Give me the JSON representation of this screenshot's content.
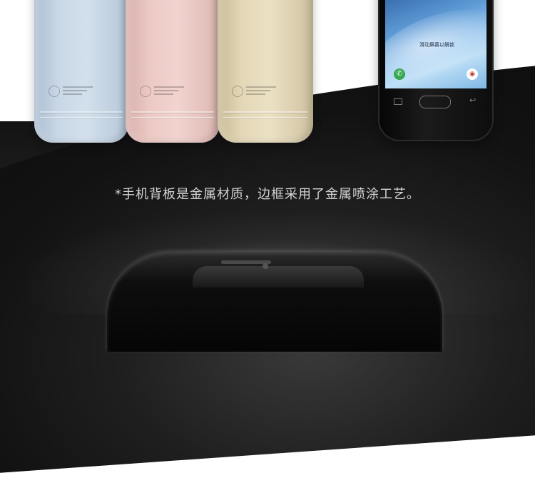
{
  "caption": "*手机背板是金属材质，边框采用了金属喷涂工艺。",
  "front_screen_text": "滑动屏幕以解锁",
  "icons": {
    "call": "phone-call-icon",
    "camera": "camera-icon",
    "recent": "recent-apps-icon",
    "home": "home-button-icon",
    "back": "back-arrow-icon"
  },
  "colors": {
    "phone_blue": "#c9d7e6",
    "phone_pink": "#ecc9c4",
    "phone_gold": "#e3d7b7",
    "phone_black": "#111111",
    "caption": "#d4d4d4"
  }
}
